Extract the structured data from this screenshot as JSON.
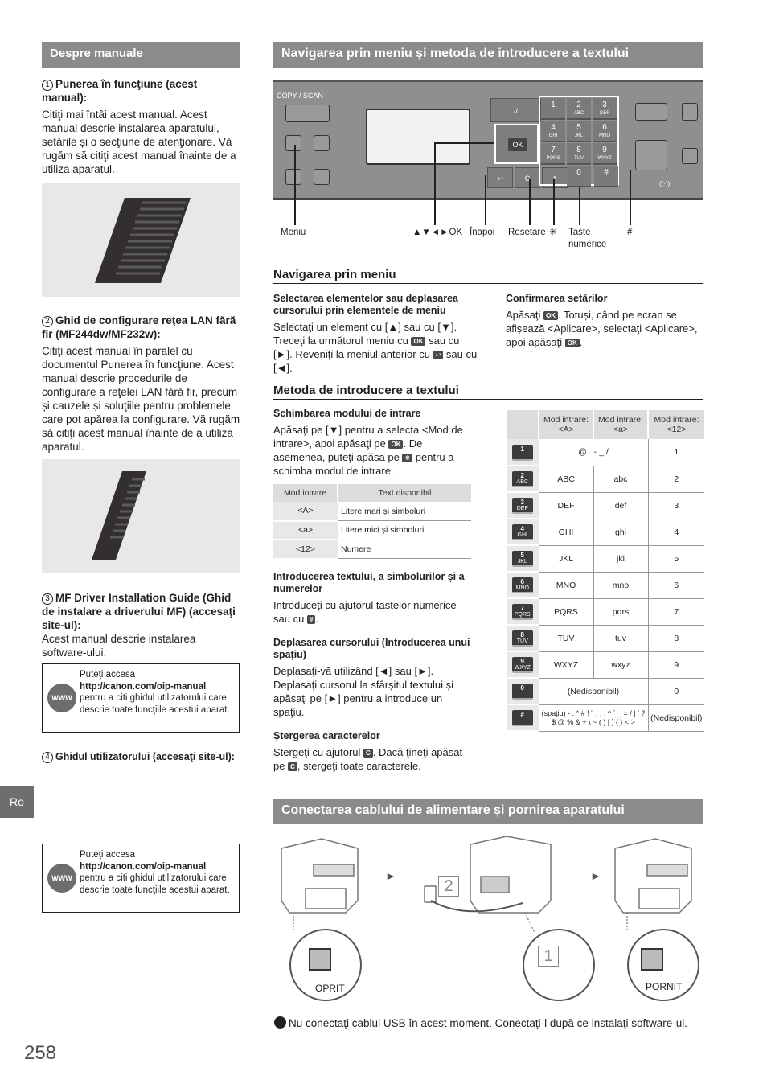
{
  "left": {
    "header": "Despre manuale",
    "items": [
      {
        "num": "1",
        "title": "Punerea în funcţiune (acest manual):",
        "body": "Citiţi mai întâi acest manual. Acest manual descrie instalarea aparatului, setările și o secţiune de atenţionare. Vă rugăm să citiţi acest manual înainte de a utiliza aparatul."
      },
      {
        "num": "2",
        "title": "Ghid de configurare reţea LAN fără fir (MF244dw/MF232w):",
        "body": "Citiţi acest manual în paralel cu documentul Punerea în funcţiune. Acest manual descrie procedurile de configurare a reţelei LAN fără fir, precum și cauzele și soluţiile pentru problemele care pot apărea la configurare. Vă rugăm să citiţi acest manual înainte de a utiliza aparatul."
      },
      {
        "num": "3",
        "title": "MF Driver Installation Guide (Ghid de instalare a driverului MF) (accesaţi site-ul):",
        "body": "Acest manual descrie instalarea software-ului."
      },
      {
        "num": "4",
        "title": "Ghidul utilizatorului (accesaţi site-ul):",
        "body": ""
      }
    ],
    "www_box": {
      "line1": "Puteţi accesa",
      "url": "http://canon.com/oip-manual",
      "line2": "pentru a citi ghidul utilizatorului care descrie toate funcţiile acestui aparat.",
      "icon": "www-globe-icon",
      "icon_label": "WWW"
    },
    "lang_tab": "Ro",
    "page_number": "258"
  },
  "nav": {
    "header": "Navigarea prin meniu și metoda de introducere a textului",
    "panel": {
      "copy_scan_label": "COPY / SCAN",
      "ok_label": "OK",
      "keys": [
        {
          "n": "1",
          "l": ""
        },
        {
          "n": "2",
          "l": "ABC"
        },
        {
          "n": "3",
          "l": "DEF"
        },
        {
          "n": "4",
          "l": "GHI"
        },
        {
          "n": "5",
          "l": "JKL"
        },
        {
          "n": "6",
          "l": "MNO"
        },
        {
          "n": "7",
          "l": "PQRS"
        },
        {
          "n": "8",
          "l": "TUV"
        },
        {
          "n": "9",
          "l": "WXYZ"
        },
        {
          "n": "0",
          "l": ""
        }
      ],
      "hash": "#",
      "star": "*",
      "clear": "C",
      "back": "↩",
      "reset": "//",
      "wifi": "((·))"
    },
    "callouts": {
      "menu": "Meniu",
      "arrows_ok": "▲▼◄►OK",
      "back": "Înapoi",
      "reset": "Resetare",
      "star": "✳",
      "numeric": "Taste numerice",
      "hash": "#"
    },
    "menu_nav": {
      "title": "Navigarea prin meniu",
      "select_title": "Selectarea elementelor sau deplasarea cursorului prin elementele de meniu",
      "select_body_1": "Selectaţi un element cu [▲] sau cu [▼]. Treceţi la următorul meniu cu",
      "select_body_2": "sau cu [►]. Reveniţi la meniul anterior cu",
      "select_body_3": "sau cu [◄].",
      "confirm_title": "Confirmarea setărilor",
      "confirm_body_1": "Apăsaţi",
      "confirm_body_2": ". Totuși, când pe ecran se afișează <Aplicare>, selectaţi <Aplicare>, apoi apăsaţi",
      "confirm_body_3": "."
    },
    "text_input": {
      "title": "Metoda de introducere a textului",
      "change_title": "Schimbarea modului de intrare",
      "change_body_1": "Apăsaţi pe [▼] pentru a selecta <Mod de intrare>, apoi apăsaţi pe",
      "change_body_2": ". De asemenea, puteţi apăsa pe",
      "change_body_3": "pentru a schimba modul de intrare.",
      "mode_table": {
        "headers": [
          "Mod intrare",
          "Text disponibil"
        ],
        "rows": [
          [
            "<A>",
            "Litere mari și simboluri"
          ],
          [
            "<a>",
            "Litere mici și simboluri"
          ],
          [
            "<12>",
            "Numere"
          ]
        ]
      },
      "enter_title": "Introducerea textului, a simbolurilor și a numerelor",
      "enter_body_1": "Introduceţi cu ajutorul tastelor numerice sau cu",
      "enter_body_2": ".",
      "cursor_title": "Deplasarea cursorului (Introducerea unui spaţiu)",
      "cursor_body": "Deplasaţi-vă utilizând [◄] sau [►]. Deplasaţi cursorul la sfârșitul textului și apăsaţi pe [►] pentru a introduce un spaţiu.",
      "delete_title": "Ștergerea caracterelor",
      "delete_body_1": "Ștergeţi cu ajutorul",
      "delete_body_2": ". Dacă ţineţi apăsat pe",
      "delete_body_3": ", ștergeţi toate caracterele.",
      "key_ok": "OK",
      "key_star": "✳",
      "key_hash": "#",
      "key_c": "C",
      "key_back": "↩",
      "char_table": {
        "headers": [
          "",
          "Mod intrare: <A>",
          "Mod intrare: <a>",
          "Mod intrare: <12>"
        ],
        "rows": [
          {
            "key": "1",
            "sub": "",
            "A": "@ . - _ /",
            "a": null,
            "n": "1"
          },
          {
            "key": "2",
            "sub": "ABC",
            "A": "ABC",
            "a": "abc",
            "n": "2"
          },
          {
            "key": "3",
            "sub": "DEF",
            "A": "DEF",
            "a": "def",
            "n": "3"
          },
          {
            "key": "4",
            "sub": "GHI",
            "A": "GHI",
            "a": "ghi",
            "n": "4"
          },
          {
            "key": "5",
            "sub": "JKL",
            "A": "JKL",
            "a": "jkl",
            "n": "5"
          },
          {
            "key": "6",
            "sub": "MNO",
            "A": "MNO",
            "a": "mno",
            "n": "6"
          },
          {
            "key": "7",
            "sub": "PQRS",
            "A": "PQRS",
            "a": "pqrs",
            "n": "7"
          },
          {
            "key": "8",
            "sub": "TUV",
            "A": "TUV",
            "a": "tuv",
            "n": "8"
          },
          {
            "key": "9",
            "sub": "WXYZ",
            "A": "WXYZ",
            "a": "wxyz",
            "n": "9"
          },
          {
            "key": "0",
            "sub": "",
            "A": "(Nedisponibil)",
            "a": null,
            "n": "0"
          },
          {
            "key": "#",
            "sub": "",
            "A": "(spaţiu) - . * # ! \" , ; : ^ ` _ = / | ' ? $ @ % & + \\ ~ ( ) [ ] { } < >",
            "a": null,
            "n": "(Nedisponibil)"
          }
        ]
      }
    }
  },
  "power": {
    "header": "Conectarea cablului de alimentare și pornirea aparatului",
    "step_off_label": "OPRIT",
    "step_on_label": "PORNIT",
    "step1": "1",
    "step2": "2",
    "arrow": "►",
    "note": "Nu conectaţi cablul USB în acest moment. Conectaţi-l după ce instalaţi software-ul."
  }
}
